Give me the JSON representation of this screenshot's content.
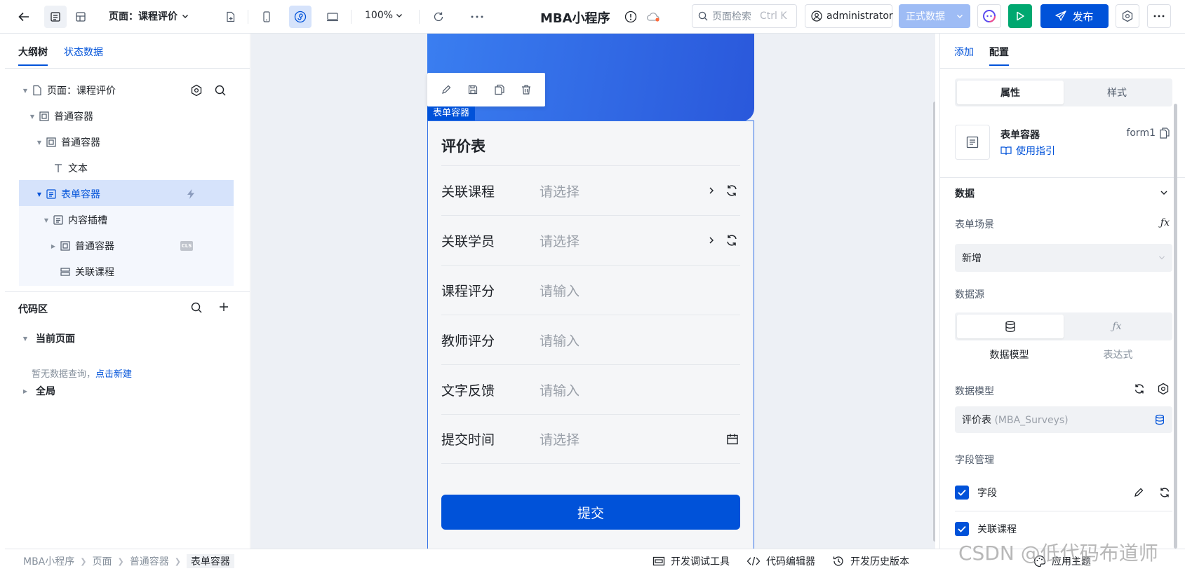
{
  "topbar": {
    "page_switch": "页面：课程评价",
    "zoom": "100%",
    "app_title": "MBA小程序",
    "search_placeholder": "页面检索",
    "search_shortcut": "Ctrl K",
    "user": "administrator",
    "env": "正式数据",
    "publish": "发布"
  },
  "left": {
    "tabs": [
      "大纲树",
      "状态数据"
    ],
    "tree": [
      {
        "label": "页面：课程评价",
        "icon": "page-icon"
      },
      {
        "label": "普通容器",
        "icon": "container-icon"
      },
      {
        "label": "普通容器",
        "icon": "container-icon"
      },
      {
        "label": "文本",
        "icon": "text-icon"
      },
      {
        "label": "表单容器",
        "icon": "form-icon"
      },
      {
        "label": "内容插槽",
        "icon": "slot-icon"
      },
      {
        "label": "普通容器",
        "icon": "container-icon",
        "badge": "CLS"
      },
      {
        "label": "关联课程",
        "icon": "field-icon"
      }
    ],
    "code": {
      "title": "代码区",
      "current_page": "当前页面",
      "empty_text": "暂无数据查询，",
      "empty_link": "点击新建",
      "global": "全局"
    }
  },
  "canvas": {
    "selection_label": "表单容器",
    "form_title": "评价表",
    "rows": [
      {
        "label": "关联课程",
        "placeholder": "请选择"
      },
      {
        "label": "关联学员",
        "placeholder": "请选择"
      },
      {
        "label": "课程评分",
        "placeholder": "请输入"
      },
      {
        "label": "教师评分",
        "placeholder": "请输入"
      },
      {
        "label": "文字反馈",
        "placeholder": "请输入"
      },
      {
        "label": "提交时间",
        "placeholder": "请选择"
      }
    ],
    "submit": "提交"
  },
  "right": {
    "tabs": [
      "添加",
      "配置"
    ],
    "seg": [
      "属性",
      "样式"
    ],
    "component_name": "表单容器",
    "component_guide": "使用指引",
    "component_id": "form1",
    "data_section": "数据",
    "form_scene_label": "表单场景",
    "form_scene_value": "新增",
    "datasource_label": "数据源",
    "datasource_options": [
      "数据模型",
      "表达式"
    ],
    "model_label": "数据模型",
    "model_name": "评价表",
    "model_code": "(MBA_Surveys)",
    "field_mgmt": "字段管理",
    "checks": [
      "字段",
      "关联课程"
    ]
  },
  "status": {
    "breadcrumbs": [
      "MBA小程序",
      "页面",
      "普通容器",
      "表单容器"
    ],
    "tools": [
      "开发调试工具",
      "代码编辑器",
      "开发历史版本"
    ],
    "theme": "应用主题"
  },
  "watermark": "CSDN @低代码布道师",
  "colors": {
    "primary": "#0052d9",
    "run": "#00a870",
    "env": "#9ebcf5"
  }
}
